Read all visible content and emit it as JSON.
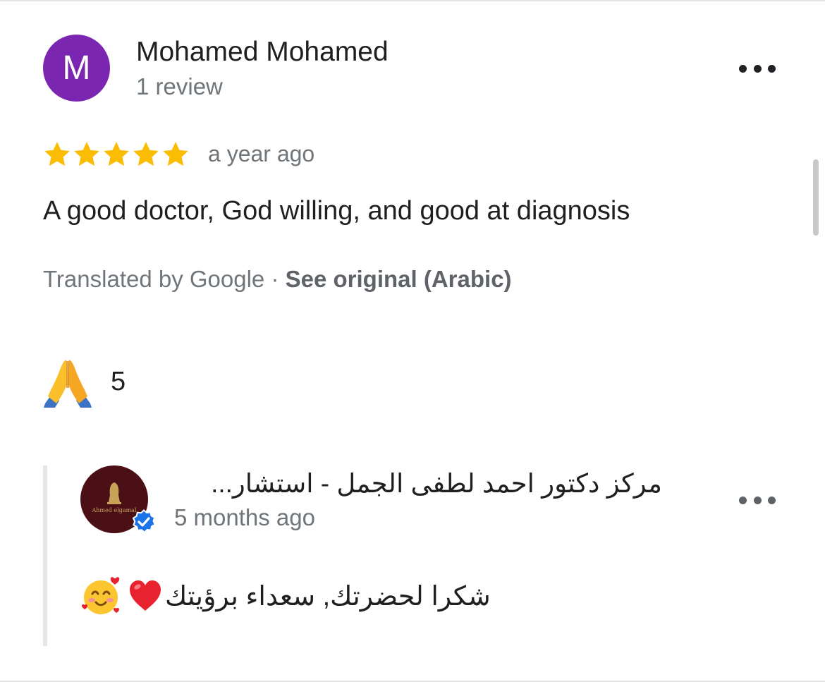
{
  "review": {
    "avatar_letter": "M",
    "avatar_color": "#7b26b0",
    "reviewer_name": "Mohamed Mohamed",
    "review_count": "1 review",
    "rating": 5,
    "star_color": "#fbbc04",
    "date": "a year ago",
    "text": "A good doctor, God willing, and good at diagnosis",
    "translated_by": "Translated by Google",
    "separator": " · ",
    "see_original": "See original (Arabic)",
    "reaction_icon": "folded-hands-icon",
    "reaction_count": "5"
  },
  "reply": {
    "business_name": "مركز دكتور احمد لطفى الجمل - استشار...",
    "date": "5 months ago",
    "text": "شكرا لحضرتك, سعداء برؤيتك",
    "verified_color": "#1a73e8",
    "logo_text": "Ahmed elgamal"
  }
}
